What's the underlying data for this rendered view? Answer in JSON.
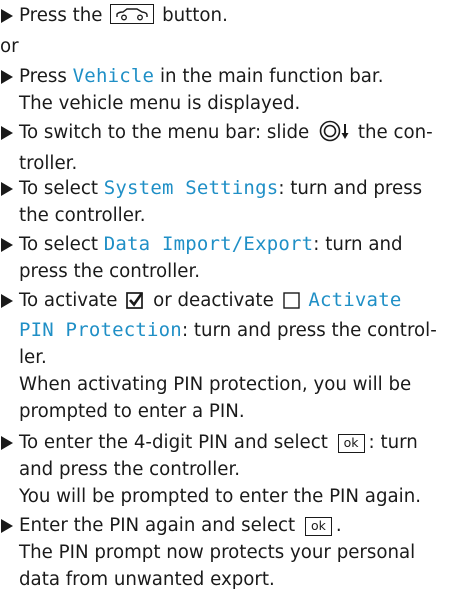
{
  "steps": {
    "s1": {
      "pre": "Press the",
      "post": "button."
    },
    "or": "or",
    "s2": {
      "pre": "Press",
      "hl": "Vehicle",
      "post": "in the main function bar.",
      "line2": "The vehicle menu is displayed."
    },
    "s3": {
      "pre": "To switch to the menu bar: slide",
      "post": "the con-",
      "line2": "troller."
    },
    "s4": {
      "pre": "To select",
      "hl": "System Settings",
      "post": ": turn and press",
      "line2": "the controller."
    },
    "s5": {
      "pre": "To select",
      "hl": "Data Import/Export",
      "post": ": turn and",
      "line2": "press the controller."
    },
    "s6": {
      "pre": "To activate",
      "mid": "or deactivate",
      "hl1": "Activate",
      "hl2": "PIN Protection",
      "post2": ": turn and press the control-",
      "line3": "ler.",
      "line4": "When activating PIN protection, you will be",
      "line5": "prompted to enter a PIN."
    },
    "s7": {
      "pre": "To enter the 4-digit PIN and select",
      "ok": "ok",
      "post": ": turn",
      "line2": "and press the controller.",
      "line3": "You will be prompted to enter the PIN again."
    },
    "s8": {
      "pre": "Enter the PIN again and select",
      "ok": "ok",
      "post": ".",
      "line2": "The PIN prompt now protects your personal",
      "line3": "data from unwanted export."
    }
  }
}
